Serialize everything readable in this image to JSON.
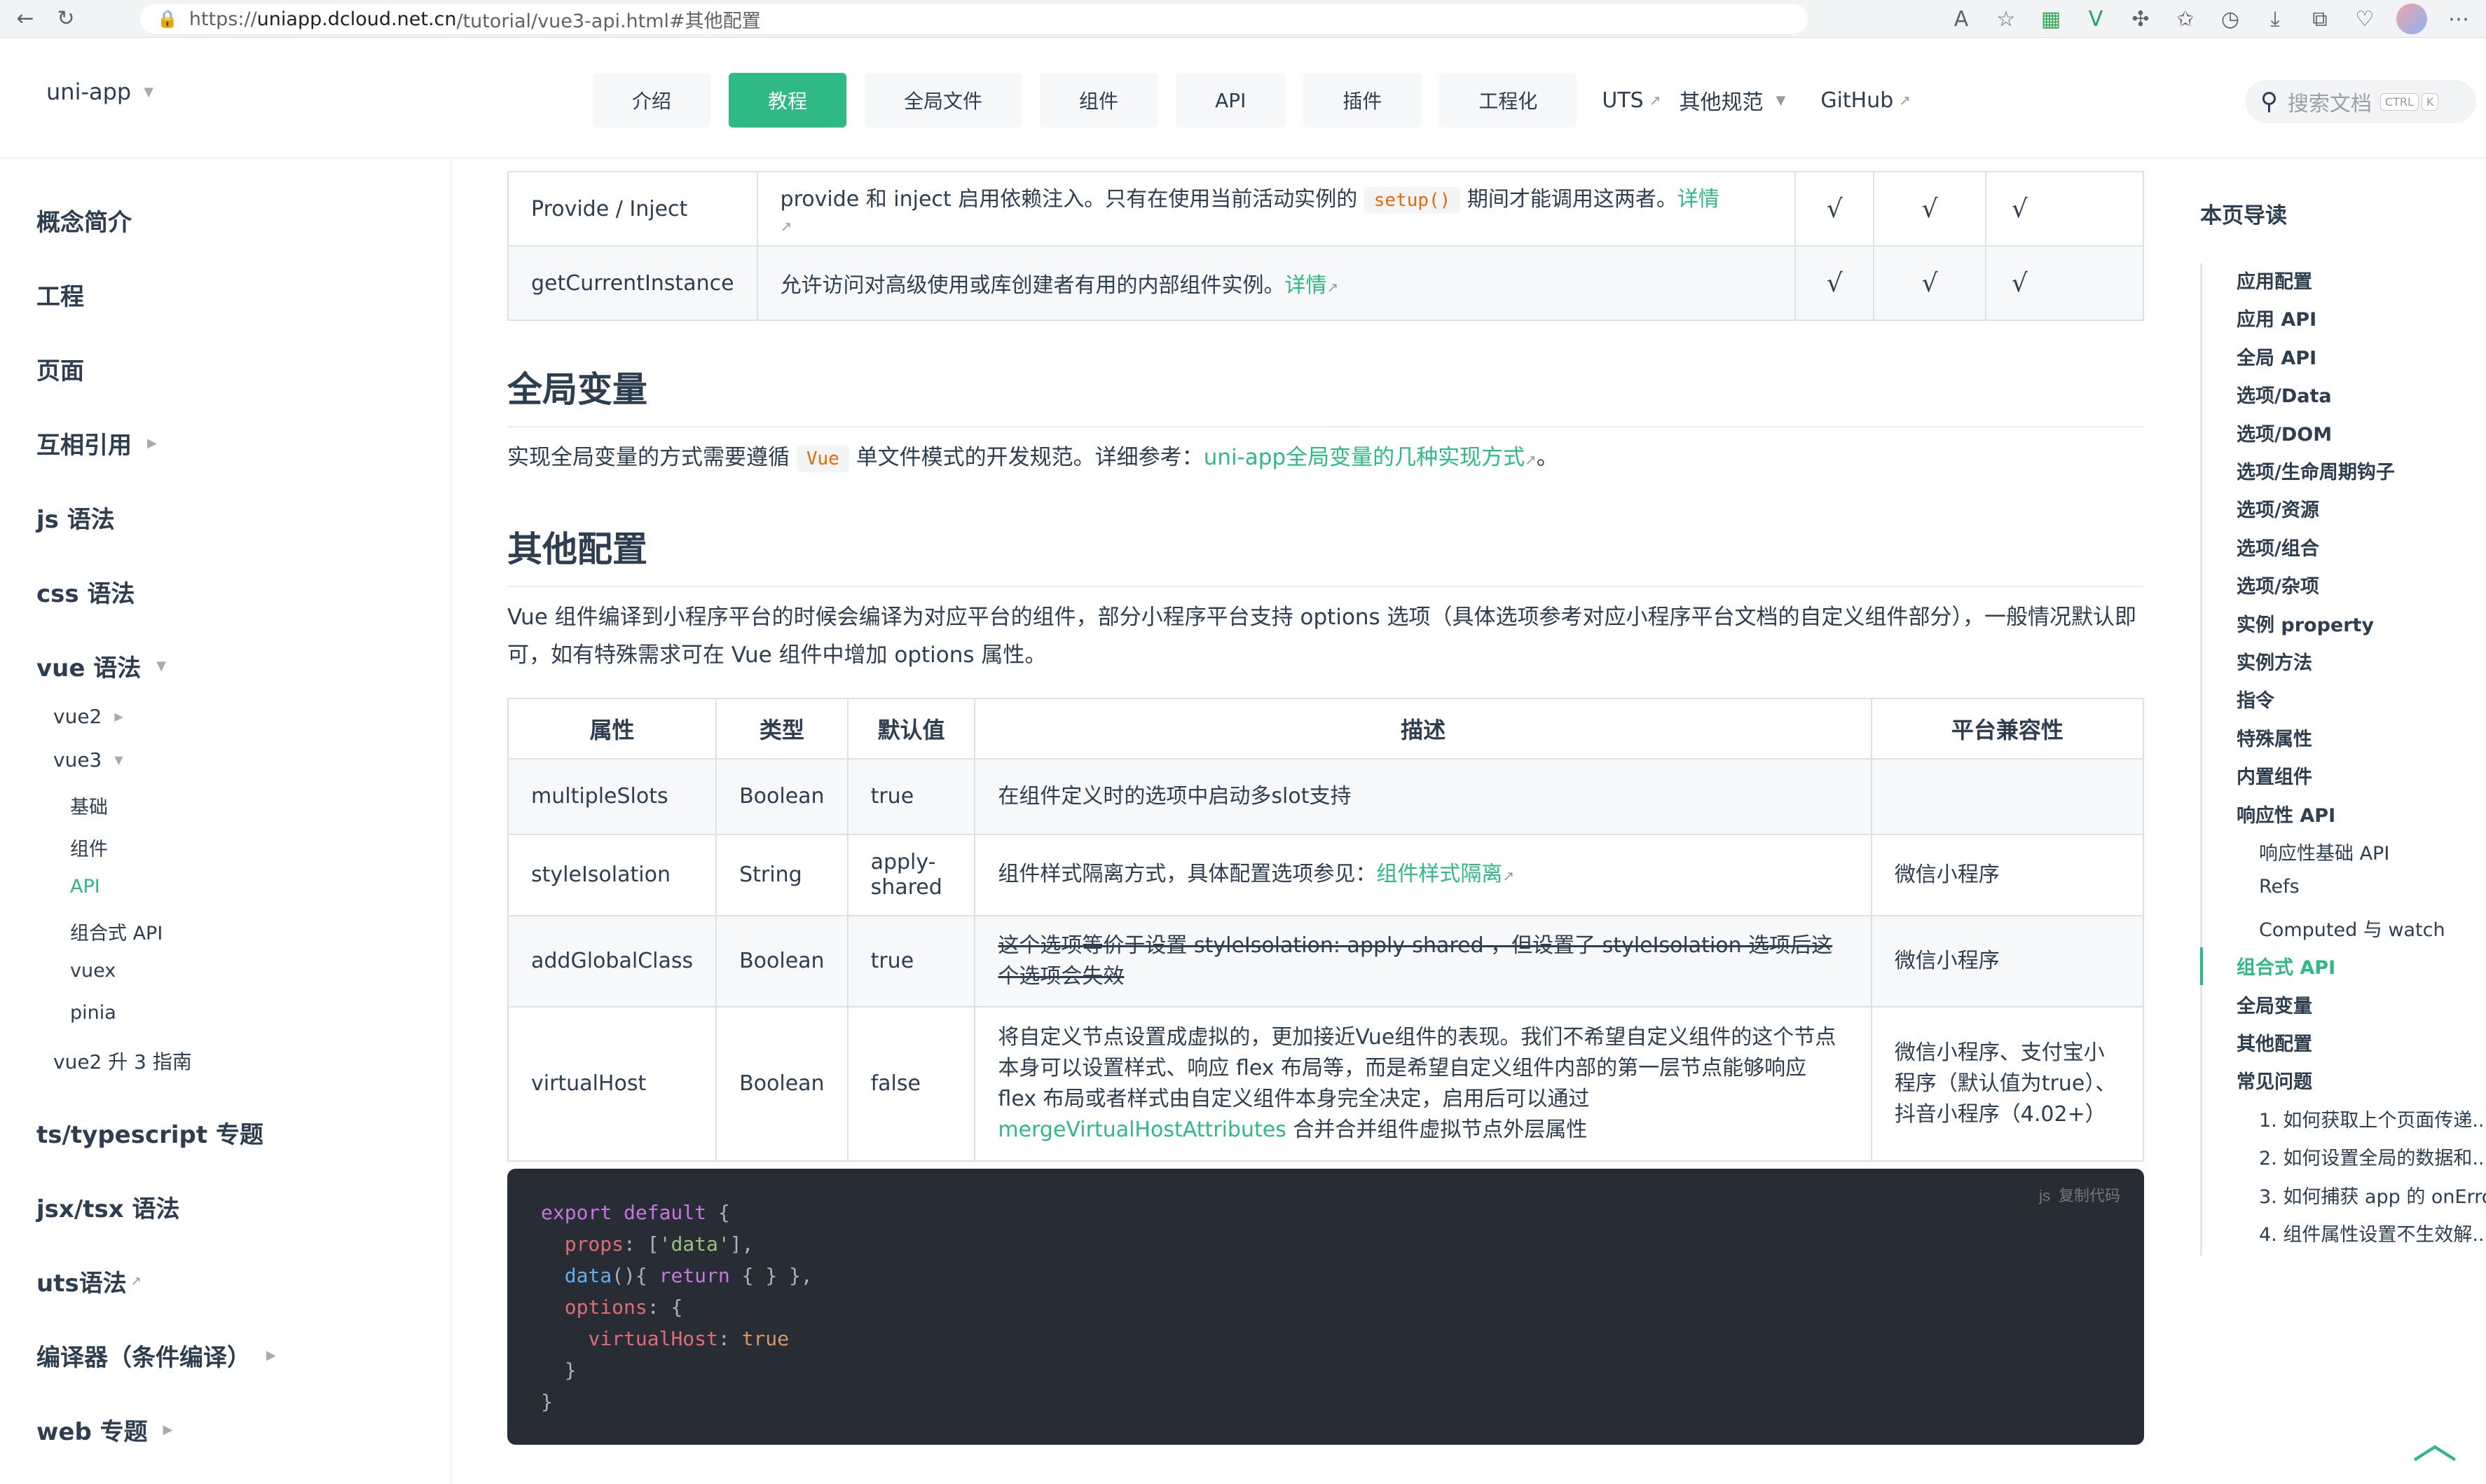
{
  "browser": {
    "url_prefix": "https://",
    "url_host": "uniapp.dcloud.net.cn",
    "url_path": "/tutorial/vue3-api.html#其他配置"
  },
  "header": {
    "brand": "uni-app",
    "tabs": [
      {
        "label": "介绍",
        "active": false
      },
      {
        "label": "教程",
        "active": true
      },
      {
        "label": "全局文件",
        "active": false
      },
      {
        "label": "组件",
        "active": false
      },
      {
        "label": "API",
        "active": false
      },
      {
        "label": "插件",
        "active": false
      },
      {
        "label": "工程化",
        "active": false
      }
    ],
    "links": {
      "uts": "UTS",
      "spec": "其他规范",
      "github": "GitHub"
    },
    "search_placeholder": "搜索文档",
    "search_kbd_1": "CTRL",
    "search_kbd_2": "K"
  },
  "sidebar": {
    "items": [
      {
        "label": "概念简介"
      },
      {
        "label": "工程"
      },
      {
        "label": "页面"
      },
      {
        "label": "互相引用"
      },
      {
        "label": "js 语法"
      },
      {
        "label": "css 语法"
      },
      {
        "label": "vue 语法"
      },
      {
        "label": "ts/typescript 专题"
      },
      {
        "label": "jsx/tsx 语法"
      },
      {
        "label": "uts语法"
      },
      {
        "label": "编译器（条件编译）"
      },
      {
        "label": "web 专题"
      }
    ],
    "vue2": "vue2",
    "vue3": "vue3",
    "vue3_children": [
      "基础",
      "组件",
      "API",
      "组合式 API",
      "vuex",
      "pinia"
    ],
    "vue2_upgrade": "vue2 升 3 指南"
  },
  "top_table": {
    "rows": [
      {
        "name": "Provide / Inject",
        "desc_a": "provide 和 inject 启用依赖注入。只有在使用当前活动实例的",
        "code": "setup()",
        "desc_b": "期间才能调用这两者。",
        "link": "详情",
        "c1": "√",
        "c2": "√",
        "c3": "√"
      },
      {
        "name": "getCurrentInstance",
        "desc_a": "允许访问对高级使用或库创建者有用的内部组件实例。",
        "link": "详情",
        "c1": "√",
        "c2": "√",
        "c3": "√"
      }
    ]
  },
  "global_vars": {
    "heading": "全局变量",
    "text_a": "实现全局变量的方式需要遵循",
    "code": "Vue",
    "text_b": "单文件模式的开发规范。详细参考：",
    "link": "uni-app全局变量的几种实现方式",
    "text_c": "。"
  },
  "other_config": {
    "heading": "其他配置",
    "paragraph": "Vue 组件编译到小程序平台的时候会编译为对应平台的组件，部分小程序平台支持 options 选项（具体选项参考对应小程序平台文档的自定义组件部分），一般情况默认即可，如有特殊需求可在 Vue 组件中增加 options 属性。",
    "columns": [
      "属性",
      "类型",
      "默认值",
      "描述",
      "平台兼容性"
    ],
    "rows": [
      {
        "prop": "multipleSlots",
        "type": "Boolean",
        "default": "true",
        "desc": "在组件定义时的选项中启动多slot支持",
        "platform": ""
      },
      {
        "prop": "styleIsolation",
        "type": "String",
        "default": "apply-shared",
        "desc": "组件样式隔离方式，具体配置选项参见：",
        "desc_link": "组件样式隔离",
        "platform": "微信小程序"
      },
      {
        "prop": "addGlobalClass",
        "type": "Boolean",
        "default": "true",
        "desc": "这个选项等价于设置 styleIsolation: apply-shared ，但设置了 styleIsolation 选项后这个选项会失效",
        "platform": "微信小程序"
      },
      {
        "prop": "virtualHost",
        "type": "Boolean",
        "default": "false",
        "desc": "将自定义节点设置成虚拟的，更加接近Vue组件的表现。我们不希望自定义组件的这个节点本身可以设置样式、响应 flex 布局等，而是希望自定义组件内部的第一层节点能够响应 flex 布局或者样式由自定义组件本身完全决定，启用后可以通过",
        "desc_link": "mergeVirtualHostAttributes",
        "desc_tail": "合并合并组件虚拟节点外层属性",
        "platform": "微信小程序、支付宝小程序（默认值为true）、抖音小程序（4.02+）"
      }
    ]
  },
  "code": {
    "lang": "js",
    "copy_label": "复制代码"
  },
  "toc": {
    "title": "本页导读",
    "items": [
      {
        "label": "应用配置",
        "sub": false,
        "active": false
      },
      {
        "label": "应用 API",
        "sub": false,
        "active": false
      },
      {
        "label": "全局 API",
        "sub": false,
        "active": false
      },
      {
        "label": "选项/Data",
        "sub": false,
        "active": false
      },
      {
        "label": "选项/DOM",
        "sub": false,
        "active": false
      },
      {
        "label": "选项/生命周期钩子",
        "sub": false,
        "active": false
      },
      {
        "label": "选项/资源",
        "sub": false,
        "active": false
      },
      {
        "label": "选项/组合",
        "sub": false,
        "active": false
      },
      {
        "label": "选项/杂项",
        "sub": false,
        "active": false
      },
      {
        "label": "实例 property",
        "sub": false,
        "active": false
      },
      {
        "label": "实例方法",
        "sub": false,
        "active": false
      },
      {
        "label": "指令",
        "sub": false,
        "active": false
      },
      {
        "label": "特殊属性",
        "sub": false,
        "active": false
      },
      {
        "label": "内置组件",
        "sub": false,
        "active": false
      },
      {
        "label": "响应性 API",
        "sub": false,
        "active": false
      },
      {
        "label": "响应性基础 API",
        "sub": true,
        "active": false
      },
      {
        "label": "Refs",
        "sub": true,
        "active": false
      },
      {
        "label": "Computed 与 watch",
        "sub": true,
        "active": false
      },
      {
        "label": "组合式 API",
        "sub": false,
        "active": true
      },
      {
        "label": "全局变量",
        "sub": false,
        "active": false
      },
      {
        "label": "其他配置",
        "sub": false,
        "active": false
      },
      {
        "label": "常见问题",
        "sub": false,
        "active": false
      },
      {
        "label": "1. 如何获取上个页面传递...",
        "sub": true,
        "active": false
      },
      {
        "label": "2. 如何设置全局的数据和...",
        "sub": true,
        "active": false
      },
      {
        "label": "3. 如何捕获 app 的 onErro",
        "sub": true,
        "active": false
      },
      {
        "label": "4. 组件属性设置不生效解...",
        "sub": true,
        "active": false
      }
    ]
  },
  "colors": {
    "accent": "#2fb984",
    "code_bg": "#282c34"
  }
}
